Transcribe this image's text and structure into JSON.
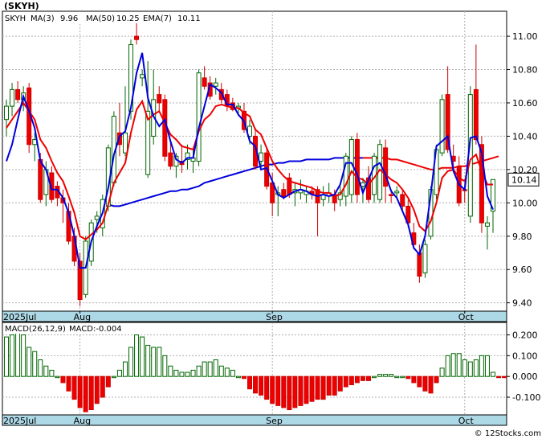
{
  "chart_data": [
    {
      "type": "candlestick",
      "title": "(SKYH)",
      "legend": {
        "symbol": "SKYH",
        "ma3_label": "MA(3)",
        "ma3_value": "9.96",
        "ma50_label": "MA(50)",
        "ma50_value": "10.25",
        "ema7_label": "EMA(7)",
        "ema7_value": "10.11"
      },
      "last_price_tag": "10.14",
      "y_ticks": [
        "11.00",
        "10.80",
        "10.60",
        "10.40",
        "10.20",
        "10.00",
        "9.80",
        "9.60",
        "9.40"
      ],
      "ylim": [
        9.35,
        11.15
      ],
      "x_labels": [
        {
          "label": "2025Jul",
          "index": 0
        },
        {
          "label": "Aug",
          "index": 13
        },
        {
          "label": "Sep",
          "index": 47
        },
        {
          "label": "Oct",
          "index": 81
        }
      ],
      "grid": true,
      "candles": [
        {
          "o": 10.5,
          "h": 10.62,
          "l": 10.4,
          "c": 10.58,
          "dir": "up"
        },
        {
          "o": 10.58,
          "h": 10.72,
          "l": 10.52,
          "c": 10.68,
          "dir": "up"
        },
        {
          "o": 10.68,
          "h": 10.73,
          "l": 10.6,
          "c": 10.62,
          "dir": "down"
        },
        {
          "o": 10.62,
          "h": 10.7,
          "l": 10.55,
          "c": 10.66,
          "dir": "up"
        },
        {
          "o": 10.69,
          "h": 10.72,
          "l": 10.3,
          "c": 10.35,
          "dir": "down"
        },
        {
          "o": 10.35,
          "h": 10.42,
          "l": 10.25,
          "c": 10.38,
          "dir": "up"
        },
        {
          "o": 10.26,
          "h": 10.3,
          "l": 10.0,
          "c": 10.02,
          "dir": "down"
        },
        {
          "o": 10.05,
          "h": 10.25,
          "l": 9.98,
          "c": 10.2,
          "dir": "up"
        },
        {
          "o": 10.18,
          "h": 10.22,
          "l": 10.0,
          "c": 10.02,
          "dir": "down"
        },
        {
          "o": 10.1,
          "h": 10.13,
          "l": 9.98,
          "c": 10.03,
          "dir": "down"
        },
        {
          "o": 10.03,
          "h": 10.08,
          "l": 9.88,
          "c": 10.0,
          "dir": "down"
        },
        {
          "o": 9.95,
          "h": 10.0,
          "l": 9.75,
          "c": 9.77,
          "dir": "down"
        },
        {
          "o": 9.8,
          "h": 9.85,
          "l": 9.62,
          "c": 9.65,
          "dir": "down"
        },
        {
          "o": 9.65,
          "h": 9.7,
          "l": 9.38,
          "c": 9.42,
          "dir": "down"
        },
        {
          "o": 9.45,
          "h": 9.8,
          "l": 9.43,
          "c": 9.77,
          "dir": "up"
        },
        {
          "o": 9.65,
          "h": 9.9,
          "l": 9.62,
          "c": 9.88,
          "dir": "up"
        },
        {
          "o": 9.9,
          "h": 9.95,
          "l": 9.82,
          "c": 9.92,
          "dir": "up"
        },
        {
          "o": 9.85,
          "h": 10.05,
          "l": 9.8,
          "c": 10.02,
          "dir": "up"
        },
        {
          "o": 9.98,
          "h": 10.35,
          "l": 9.95,
          "c": 10.33,
          "dir": "up"
        },
        {
          "o": 10.12,
          "h": 10.55,
          "l": 10.1,
          "c": 10.52,
          "dir": "up"
        },
        {
          "o": 10.42,
          "h": 10.6,
          "l": 10.28,
          "c": 10.35,
          "dir": "down"
        },
        {
          "o": 10.3,
          "h": 10.7,
          "l": 10.28,
          "c": 10.42,
          "dir": "up"
        },
        {
          "o": 10.55,
          "h": 10.98,
          "l": 10.5,
          "c": 10.95,
          "dir": "up"
        },
        {
          "o": 11.0,
          "h": 11.08,
          "l": 10.95,
          "c": 10.98,
          "dir": "down"
        },
        {
          "o": 10.75,
          "h": 10.8,
          "l": 10.7,
          "c": 10.77,
          "dir": "up"
        },
        {
          "o": 10.55,
          "h": 10.85,
          "l": 10.15,
          "c": 10.17,
          "dir": "up"
        },
        {
          "o": 10.4,
          "h": 10.8,
          "l": 10.35,
          "c": 10.62,
          "dir": "up"
        },
        {
          "o": 10.65,
          "h": 10.7,
          "l": 10.55,
          "c": 10.6,
          "dir": "down"
        },
        {
          "o": 10.62,
          "h": 10.65,
          "l": 10.25,
          "c": 10.28,
          "dir": "down"
        },
        {
          "o": 10.3,
          "h": 10.38,
          "l": 10.2,
          "c": 10.22,
          "dir": "down"
        },
        {
          "o": 10.22,
          "h": 10.3,
          "l": 10.15,
          "c": 10.28,
          "dir": "up"
        },
        {
          "o": 10.25,
          "h": 10.35,
          "l": 10.18,
          "c": 10.23,
          "dir": "down"
        },
        {
          "o": 10.26,
          "h": 10.35,
          "l": 10.2,
          "c": 10.3,
          "dir": "up"
        },
        {
          "o": 10.25,
          "h": 10.32,
          "l": 10.18,
          "c": 10.27,
          "dir": "up"
        },
        {
          "o": 10.25,
          "h": 10.8,
          "l": 10.22,
          "c": 10.78,
          "dir": "up"
        },
        {
          "o": 10.75,
          "h": 10.82,
          "l": 10.68,
          "c": 10.7,
          "dir": "down"
        },
        {
          "o": 10.72,
          "h": 10.76,
          "l": 10.62,
          "c": 10.64,
          "dir": "down"
        },
        {
          "o": 10.7,
          "h": 10.75,
          "l": 10.65,
          "c": 10.72,
          "dir": "up"
        },
        {
          "o": 10.68,
          "h": 10.72,
          "l": 10.6,
          "c": 10.62,
          "dir": "down"
        },
        {
          "o": 10.65,
          "h": 10.68,
          "l": 10.55,
          "c": 10.58,
          "dir": "down"
        },
        {
          "o": 10.6,
          "h": 10.63,
          "l": 10.55,
          "c": 10.56,
          "dir": "down"
        },
        {
          "o": 10.57,
          "h": 10.6,
          "l": 10.52,
          "c": 10.58,
          "dir": "up"
        },
        {
          "o": 10.55,
          "h": 10.6,
          "l": 10.42,
          "c": 10.44,
          "dir": "down"
        },
        {
          "o": 10.4,
          "h": 10.5,
          "l": 10.35,
          "c": 10.46,
          "dir": "up"
        },
        {
          "o": 10.4,
          "h": 10.45,
          "l": 10.2,
          "c": 10.22,
          "dir": "down"
        },
        {
          "o": 10.25,
          "h": 10.35,
          "l": 10.2,
          "c": 10.3,
          "dir": "up"
        },
        {
          "o": 10.3,
          "h": 10.33,
          "l": 10.08,
          "c": 10.1,
          "dir": "down"
        },
        {
          "o": 10.12,
          "h": 10.18,
          "l": 9.92,
          "c": 10.0,
          "dir": "down"
        },
        {
          "o": 10.05,
          "h": 10.1,
          "l": 9.92,
          "c": 10.06,
          "dir": "up"
        },
        {
          "o": 10.08,
          "h": 10.12,
          "l": 10.02,
          "c": 10.04,
          "dir": "down"
        },
        {
          "o": 10.15,
          "h": 10.18,
          "l": 10.03,
          "c": 10.05,
          "dir": "down"
        },
        {
          "o": 10.06,
          "h": 10.12,
          "l": 9.98,
          "c": 10.08,
          "dir": "up"
        },
        {
          "o": 10.06,
          "h": 10.14,
          "l": 10.02,
          "c": 10.08,
          "dir": "up"
        },
        {
          "o": 10.05,
          "h": 10.1,
          "l": 10.0,
          "c": 10.07,
          "dir": "up"
        },
        {
          "o": 10.07,
          "h": 10.1,
          "l": 10.02,
          "c": 10.05,
          "dir": "down"
        },
        {
          "o": 10.08,
          "h": 10.1,
          "l": 9.8,
          "c": 10.0,
          "dir": "down"
        },
        {
          "o": 10.02,
          "h": 10.1,
          "l": 9.98,
          "c": 10.05,
          "dir": "up"
        },
        {
          "o": 10.04,
          "h": 10.12,
          "l": 10.0,
          "c": 10.06,
          "dir": "up"
        },
        {
          "o": 10.05,
          "h": 10.08,
          "l": 9.95,
          "c": 10.0,
          "dir": "down"
        },
        {
          "o": 10.02,
          "h": 10.1,
          "l": 9.98,
          "c": 10.06,
          "dir": "up"
        },
        {
          "o": 10.04,
          "h": 10.3,
          "l": 9.98,
          "c": 10.28,
          "dir": "up"
        },
        {
          "o": 10.05,
          "h": 10.4,
          "l": 10.0,
          "c": 10.38,
          "dir": "up"
        },
        {
          "o": 10.38,
          "h": 10.42,
          "l": 10.0,
          "c": 10.05,
          "dir": "down"
        },
        {
          "o": 10.1,
          "h": 10.15,
          "l": 10.0,
          "c": 10.12,
          "dir": "up"
        },
        {
          "o": 10.15,
          "h": 10.22,
          "l": 10.0,
          "c": 10.02,
          "dir": "down"
        },
        {
          "o": 10.05,
          "h": 10.3,
          "l": 10.0,
          "c": 10.28,
          "dir": "up"
        },
        {
          "o": 10.02,
          "h": 10.38,
          "l": 10.0,
          "c": 10.35,
          "dir": "up"
        },
        {
          "o": 10.33,
          "h": 10.38,
          "l": 10.0,
          "c": 10.1,
          "dir": "down"
        },
        {
          "o": 10.05,
          "h": 10.08,
          "l": 10.0,
          "c": 10.05,
          "dir": "down"
        },
        {
          "o": 10.06,
          "h": 10.1,
          "l": 10.02,
          "c": 10.07,
          "dir": "up"
        },
        {
          "o": 10.05,
          "h": 10.08,
          "l": 9.95,
          "c": 9.98,
          "dir": "down"
        },
        {
          "o": 9.98,
          "h": 10.02,
          "l": 9.85,
          "c": 9.88,
          "dir": "down"
        },
        {
          "o": 9.82,
          "h": 9.88,
          "l": 9.72,
          "c": 9.75,
          "dir": "down"
        },
        {
          "o": 9.7,
          "h": 9.75,
          "l": 9.52,
          "c": 9.56,
          "dir": "down"
        },
        {
          "o": 9.58,
          "h": 9.78,
          "l": 9.55,
          "c": 9.75,
          "dir": "up"
        },
        {
          "o": 9.8,
          "h": 10.1,
          "l": 9.78,
          "c": 10.08,
          "dir": "up"
        },
        {
          "o": 10.05,
          "h": 10.35,
          "l": 10.02,
          "c": 10.32,
          "dir": "up"
        },
        {
          "o": 10.3,
          "h": 10.65,
          "l": 10.28,
          "c": 10.62,
          "dir": "up"
        },
        {
          "o": 10.65,
          "h": 10.82,
          "l": 10.3,
          "c": 10.32,
          "dir": "down"
        },
        {
          "o": 10.28,
          "h": 10.35,
          "l": 10.2,
          "c": 10.25,
          "dir": "down"
        },
        {
          "o": 10.22,
          "h": 10.28,
          "l": 9.98,
          "c": 10.0,
          "dir": "down"
        },
        {
          "o": 10.08,
          "h": 10.12,
          "l": 10.0,
          "c": 10.08,
          "dir": "down"
        },
        {
          "o": 9.92,
          "h": 10.7,
          "l": 9.88,
          "c": 10.65,
          "dir": "up"
        },
        {
          "o": 10.68,
          "h": 10.95,
          "l": 10.35,
          "c": 10.38,
          "dir": "down"
        },
        {
          "o": 10.35,
          "h": 10.4,
          "l": 9.82,
          "c": 9.88,
          "dir": "down"
        },
        {
          "o": 9.86,
          "h": 9.92,
          "l": 9.72,
          "c": 9.88,
          "dir": "up"
        },
        {
          "o": 9.95,
          "h": 10.12,
          "l": 9.82,
          "c": 10.14,
          "dir": "up"
        }
      ],
      "series": [
        {
          "name": "MA(3)",
          "color": "#0000dd",
          "values": [
            10.25,
            10.35,
            10.5,
            10.64,
            10.55,
            10.45,
            10.25,
            10.2,
            10.08,
            10.08,
            10.03,
            9.94,
            9.8,
            9.61,
            9.61,
            9.77,
            9.86,
            9.94,
            10.09,
            10.29,
            10.4,
            10.43,
            10.57,
            10.78,
            10.9,
            10.63,
            10.52,
            10.46,
            10.5,
            10.37,
            10.26,
            10.24,
            10.27,
            10.27,
            10.45,
            10.58,
            10.71,
            10.69,
            10.66,
            10.59,
            10.59,
            10.53,
            10.49,
            10.37,
            10.34,
            10.2,
            10.21,
            10.13,
            10.05,
            10.03,
            10.05,
            10.07,
            10.08,
            10.07,
            10.05,
            10.04,
            10.05,
            10.04,
            10.05,
            10.11,
            10.24,
            10.24,
            10.17,
            10.06,
            10.14,
            10.22,
            10.24,
            10.17,
            10.07,
            10.03,
            9.95,
            9.87,
            9.73,
            9.69,
            9.8,
            10.05,
            10.34,
            10.37,
            10.4,
            10.19,
            10.11,
            10.08,
            10.39,
            10.4,
            10.3,
            10.04,
            9.96
          ]
        },
        {
          "name": "EMA(7)",
          "color": "#ee0000",
          "values": [
            10.45,
            10.5,
            10.55,
            10.6,
            10.55,
            10.5,
            10.38,
            10.33,
            10.25,
            10.18,
            10.13,
            10.04,
            9.94,
            9.8,
            9.78,
            9.81,
            9.84,
            9.88,
            9.99,
            10.12,
            10.18,
            10.24,
            10.42,
            10.56,
            10.61,
            10.5,
            10.53,
            10.55,
            10.48,
            10.41,
            10.38,
            10.34,
            10.33,
            10.32,
            10.43,
            10.5,
            10.53,
            10.58,
            10.59,
            10.58,
            10.57,
            10.57,
            10.54,
            10.52,
            10.44,
            10.41,
            10.33,
            10.25,
            10.2,
            10.16,
            10.13,
            10.12,
            10.11,
            10.1,
            10.09,
            10.07,
            10.06,
            10.06,
            10.04,
            10.05,
            10.11,
            10.19,
            10.15,
            10.14,
            10.11,
            10.15,
            10.2,
            10.17,
            10.14,
            10.12,
            10.08,
            10.03,
            9.96,
            9.86,
            9.83,
            9.89,
            10.0,
            10.15,
            10.19,
            10.2,
            10.15,
            10.13,
            10.26,
            10.29,
            10.19,
            10.11,
            10.11
          ]
        },
        {
          "name": "MA(50)",
          "color": "#0000dd",
          "start_index": 18,
          "values": [
            9.99,
            9.98,
            9.98,
            9.99,
            10.0,
            10.01,
            10.02,
            10.03,
            10.04,
            10.05,
            10.06,
            10.07,
            10.07,
            10.08,
            10.08,
            10.09,
            10.1,
            10.12,
            10.13,
            10.14,
            10.15,
            10.16,
            10.17,
            10.18,
            10.19,
            10.2,
            10.21,
            10.22,
            10.23,
            10.23,
            10.24,
            10.24,
            10.25,
            10.25,
            10.25,
            10.26,
            10.26,
            10.26,
            10.26,
            10.26,
            10.27,
            10.27,
            10.27,
            10.27,
            10.27,
            10.27,
            10.27,
            10.27,
            10.27,
            10.27,
            10.26,
            10.26,
            10.25,
            10.24,
            10.23,
            10.22,
            10.21,
            10.2,
            10.2,
            10.21,
            10.21,
            10.21,
            10.22,
            10.22,
            10.23,
            10.24,
            10.25,
            10.26,
            10.27,
            10.28
          ],
          "split_index": 63,
          "after_color": "#ee0000"
        }
      ]
    },
    {
      "type": "bar",
      "title": "MACD(26,12,9)",
      "label": "MACD:-0.004",
      "y_ticks": [
        "0.200",
        "0.100",
        "0.000",
        "-0.100"
      ],
      "ylim": [
        -0.185,
        0.26
      ],
      "values": [
        0.19,
        0.2,
        0.21,
        0.2,
        0.14,
        0.12,
        0.08,
        0.05,
        0.03,
        0.0,
        -0.03,
        -0.07,
        -0.11,
        -0.15,
        -0.17,
        -0.16,
        -0.13,
        -0.1,
        -0.05,
        0.0,
        0.03,
        0.07,
        0.14,
        0.2,
        0.19,
        0.15,
        0.14,
        0.14,
        0.1,
        0.05,
        0.03,
        0.02,
        0.02,
        0.03,
        0.05,
        0.07,
        0.07,
        0.08,
        0.05,
        0.04,
        0.03,
        0.0,
        -0.01,
        -0.06,
        -0.08,
        -0.09,
        -0.11,
        -0.13,
        -0.14,
        -0.15,
        -0.16,
        -0.15,
        -0.14,
        -0.13,
        -0.12,
        -0.11,
        -0.11,
        -0.09,
        -0.09,
        -0.07,
        -0.05,
        -0.04,
        -0.03,
        -0.02,
        -0.02,
        0.0,
        0.01,
        0.01,
        0.01,
        0.0,
        0.0,
        -0.01,
        -0.03,
        -0.05,
        -0.07,
        -0.08,
        -0.03,
        0.04,
        0.1,
        0.11,
        0.11,
        0.08,
        0.07,
        0.08,
        0.1,
        0.1,
        0.02,
        -0.005,
        -0.004
      ]
    }
  ],
  "watermark": "© 12Stocks.com"
}
